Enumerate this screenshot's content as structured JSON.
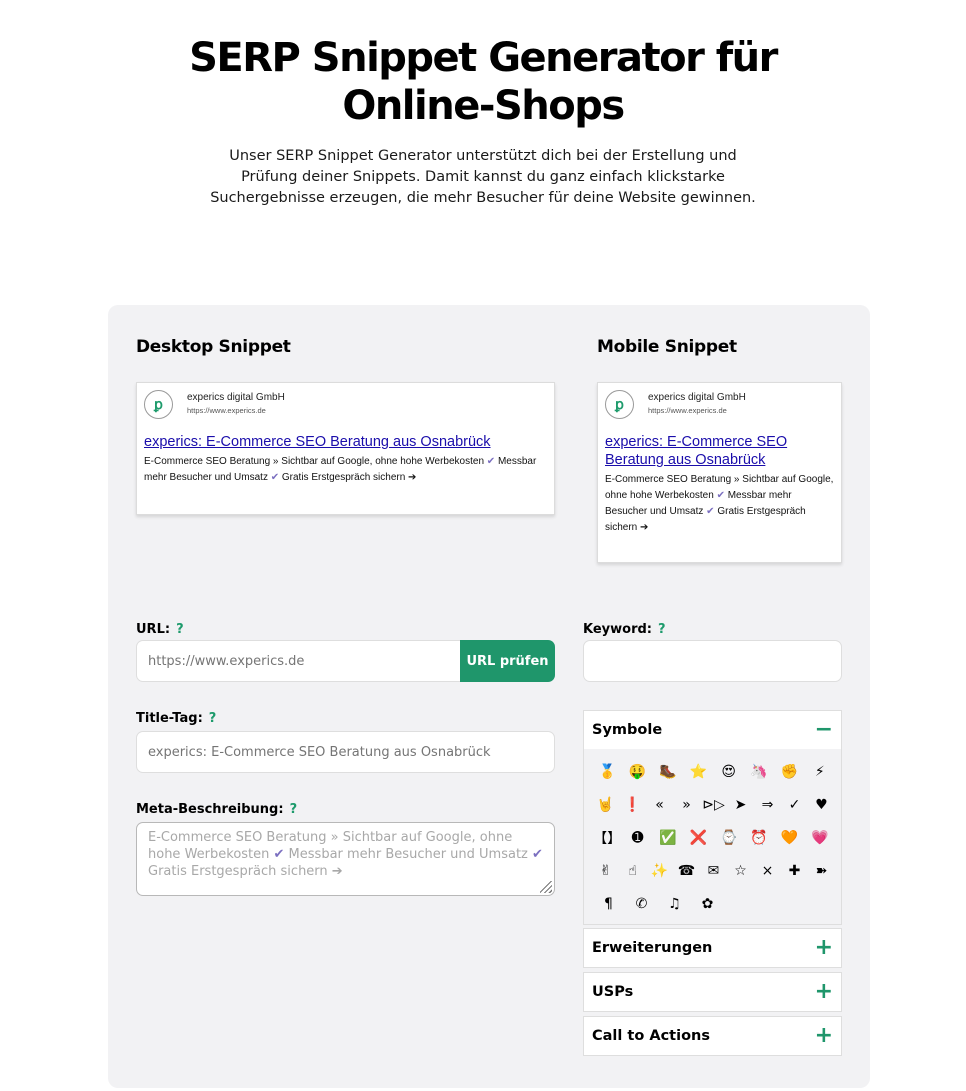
{
  "hero": {
    "title": "SERP Snippet Generator für Online-Shops",
    "description": "Unser SERP Snippet Generator unterstützt dich bei der Erstellung und Prüfung deiner Snippets. Damit kannst du ganz einfach klickstarke Suchergebnisse erzeugen, die mehr Besucher für deine Website gewinnen."
  },
  "desktop_snippet": {
    "heading": "Desktop Snippet",
    "site_name": "experics digital GmbH",
    "site_url": "https://www.experics.de",
    "favicon": "ꝑ",
    "title": "experics: E-Commerce SEO Beratung aus Osnabrück",
    "desc_part1": "E-Commerce SEO Beratung » Sichtbar auf Google, ohne hohe Werbekosten ",
    "check": "✔",
    "desc_part2": " Messbar mehr Besucher und Umsatz ",
    "desc_part3": " Gratis Erstgespräch sichern ➔"
  },
  "mobile_snippet": {
    "heading": "Mobile Snippet",
    "site_name": "experics digital GmbH",
    "site_url": "https://www.experics.de",
    "favicon": "ꝑ",
    "title": "experics: E-Commerce SEO Beratung aus Osnabrück",
    "desc_part1": "E-Commerce SEO Beratung » Sichtbar auf Google, ohne hohe Werbekosten ",
    "check": "✔",
    "desc_part2": " Messbar mehr Besucher und Umsatz ",
    "desc_part3": " Gratis Erstgespräch sichern ➔"
  },
  "form": {
    "url_label": "URL:",
    "help": "?",
    "url_placeholder": "https://www.experics.de",
    "url_button": "URL prüfen",
    "keyword_label": "Keyword:",
    "keyword_value": "",
    "title_label": "Title-Tag:",
    "title_placeholder": "experics: E-Commerce SEO Beratung aus Osnabrück",
    "meta_label": "Meta-Beschreibung:",
    "meta_part1": "E-Commerce SEO Beratung » Sichtbar auf Google, ohne hohe Werbekosten ",
    "meta_check": "✔",
    "meta_part2": " Messbar mehr Besucher und Umsatz ",
    "meta_part3": " Gratis Erstgespräch sichern ➔"
  },
  "accordion": {
    "symbols": {
      "label": "Symbole",
      "toggle": "−",
      "rows": [
        [
          "🥇",
          "🤑",
          "🥾",
          "⭐",
          "😍",
          "🦄",
          "✊",
          "⚡"
        ],
        [
          "🤘",
          "❗",
          "«",
          "»",
          "⊳▷",
          "➤",
          "⇒",
          "✓",
          "♥"
        ],
        [
          "【】",
          "➊",
          "✅",
          "❌",
          "⌚",
          "⏰",
          "🧡",
          "💗"
        ],
        [
          "✌",
          "☝",
          "✨",
          "☎",
          "✉",
          "☆",
          "×",
          "✚",
          "➽"
        ],
        [
          "¶",
          "✆",
          "♫",
          "✿"
        ]
      ]
    },
    "sections": [
      {
        "label": "Erweiterungen",
        "toggle": "+"
      },
      {
        "label": "USPs",
        "toggle": "+"
      },
      {
        "label": "Call to Actions",
        "toggle": "+"
      }
    ]
  },
  "colors": {
    "accent": "#1f966b",
    "link": "#1a0dab",
    "panel_bg": "#f2f2f4"
  }
}
